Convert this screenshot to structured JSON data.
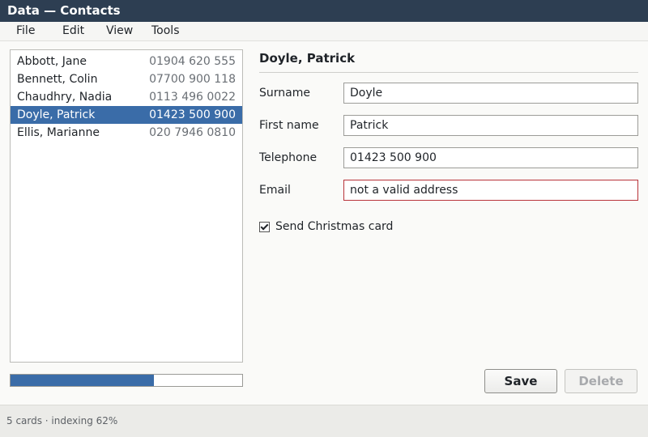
{
  "window": {
    "title": "Data — Contacts"
  },
  "menu": [
    "File",
    "Edit",
    "View",
    "Tools"
  ],
  "contacts": [
    {
      "name": "Abbott, Jane",
      "phone": "01904 620 555"
    },
    {
      "name": "Bennett, Colin",
      "phone": "07700 900 118"
    },
    {
      "name": "Chaudhry, Nadia",
      "phone": "0113 496 0022"
    },
    {
      "name": "Doyle, Patrick",
      "phone": "01423 500 900"
    },
    {
      "name": "Ellis, Marianne",
      "phone": "020 7946 0810"
    }
  ],
  "selected_index": 3,
  "progress": {
    "percent": 62
  },
  "detail": {
    "title": "Doyle, Patrick",
    "fields": {
      "surname": {
        "label": "Surname",
        "value": "Doyle"
      },
      "first_name": {
        "label": "First name",
        "value": "Patrick"
      },
      "telephone": {
        "label": "Telephone",
        "value": "01423 500 900"
      },
      "email": {
        "label": "Email",
        "value": "not a valid address"
      }
    },
    "christmas_card": {
      "label": "Send Christmas card",
      "checked": true
    }
  },
  "buttons": {
    "save": "Save",
    "delete": "Delete"
  },
  "status": {
    "text": "5 cards · indexing 62%"
  },
  "colors": {
    "accent": "#3a6ca8",
    "title_bar": "#2d3e52",
    "invalid_border": "#b8333a"
  }
}
